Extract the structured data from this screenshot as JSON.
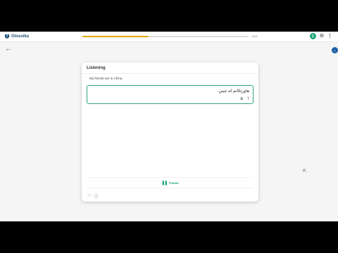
{
  "header": {
    "brand": "Glossika",
    "progress_fraction": 0.4,
    "progress_count": "6/15",
    "level_badge": "1",
    "settings_icon": "gear-icon",
    "menu_icon": "kebab-menu-icon"
  },
  "nav": {
    "back_icon": "arrow-left-icon",
    "side_button_icon": "chevron-down-icon"
  },
  "card": {
    "title": "Listening",
    "prompt": "My friends are in China.",
    "answer": "هاورێکانم لە چینن.",
    "answer_icons": [
      "copy-icon",
      "text-format-icon"
    ],
    "pause_label": "Pause",
    "footer_icons": [
      "heart-icon",
      "info-icon"
    ]
  },
  "colors": {
    "accent": "#1fa67a",
    "progress": "#e0a800",
    "brand": "#1e4d6b"
  }
}
